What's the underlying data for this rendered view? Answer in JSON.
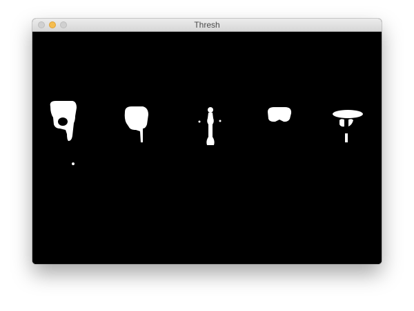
{
  "window": {
    "title": "Thresh",
    "buttons": {
      "close": "close-button",
      "minimize": "minimize-button",
      "zoom": "zoom-button"
    },
    "colors": {
      "minimize": "#f5bd4f",
      "inactive": "#d0d0d0"
    }
  },
  "image": {
    "background": "#000000",
    "foreground": "#ffffff",
    "blob_count": 5
  }
}
